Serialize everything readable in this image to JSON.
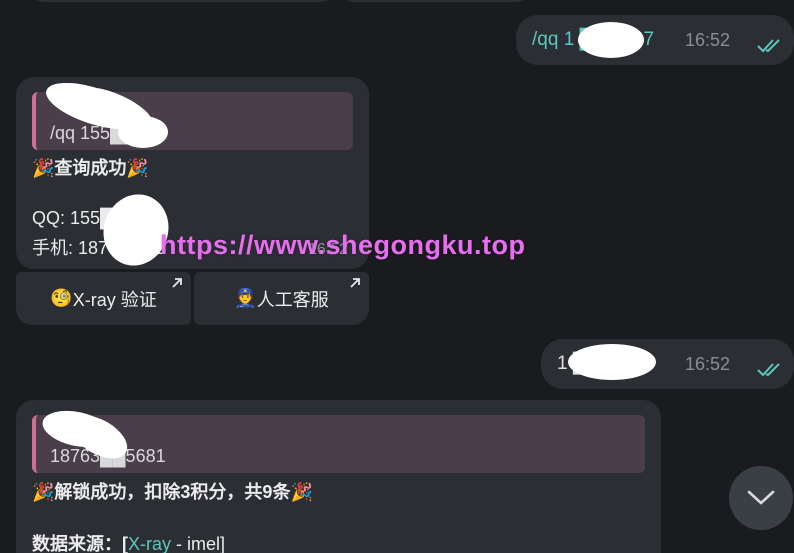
{
  "outgoing": [
    {
      "text": "/qq 1 ██ 2567",
      "time": "16:52"
    },
    {
      "text": "1 ██ 81",
      "time": "16:52"
    }
  ],
  "message1": {
    "reply_text": "/qq 155██567",
    "title_emoji_left": "🎉",
    "title": "查询成功",
    "title_emoji_right": "🎉",
    "qq_line": "QQ: 155██67",
    "phone_line": "手机: 1876██81",
    "time": "16:52"
  },
  "keyboard": [
    {
      "emoji": "🧐",
      "label": "X-ray 验证"
    },
    {
      "emoji": "👮",
      "label": "人工客服"
    }
  ],
  "message2": {
    "reply_text": "18763██5681",
    "title_emoji_left": "🎉",
    "title": "解锁成功，扣除3积分，共9条",
    "title_emoji_right": "🎉",
    "source_prefix": "数据来源：[",
    "source_link": "X-ray",
    "source_suffix": " - imel]"
  },
  "watermark": "https://www.shegongku.top",
  "colors": {
    "background": "#1a1b1f",
    "bubble": "#2b2e33",
    "accent_teal": "#5cc7be",
    "reply_bg": "#4a3e4b",
    "reply_bar": "#cf6f93",
    "watermark": "#e86ef0"
  },
  "icons": {
    "read_receipt": "double-check-icon",
    "external": "arrow-up-right-icon",
    "scroll": "chevron-down-icon"
  }
}
